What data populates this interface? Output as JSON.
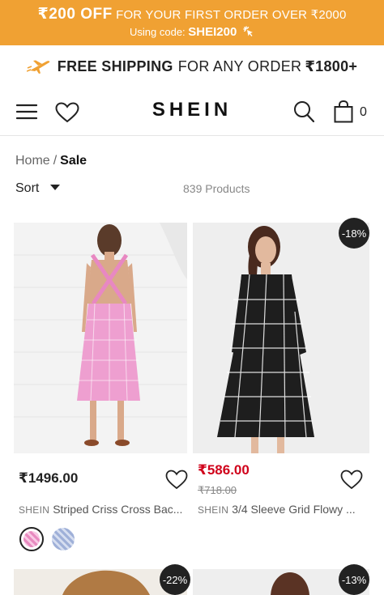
{
  "promo": {
    "amount": "₹200 OFF",
    "text": "FOR YOUR FIRST ORDER OVER ₹2000",
    "code_label": "Using code:",
    "code": "SHEI200"
  },
  "shipping": {
    "bold": "FREE SHIPPING",
    "text": "FOR ANY ORDER",
    "amount": "₹1800+"
  },
  "header": {
    "logo": "SHEIN",
    "cart_count": "0"
  },
  "breadcrumb": {
    "home": "Home",
    "separator": "/",
    "current": "Sale"
  },
  "listing": {
    "sort_label": "Sort",
    "product_count": "839 Products"
  },
  "products": [
    {
      "price": "₹1496.00",
      "brand": "SHEIN",
      "name": "Striped Criss Cross Bac...",
      "swatch_colors": [
        "#e88ac0",
        "#9fb0d8"
      ]
    },
    {
      "discount": "-18%",
      "price": "₹586.00",
      "original_price": "₹718.00",
      "brand": "SHEIN",
      "name": "3/4 Sleeve Grid Flowy ..."
    },
    {
      "discount": "-22%"
    },
    {
      "discount": "-13%"
    }
  ],
  "colors": {
    "promo_bg": "#f0a133",
    "sale_red": "#d0021b",
    "badge_bg": "#222222"
  }
}
